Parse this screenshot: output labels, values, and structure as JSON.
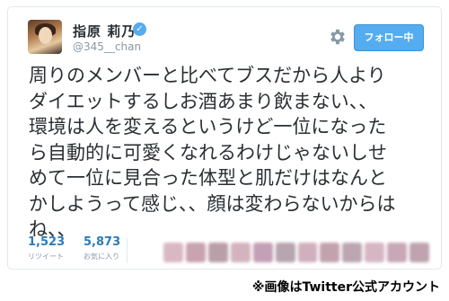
{
  "profile": {
    "display_name": "指原 莉乃",
    "handle": "@345__chan",
    "verified_mark": "✓"
  },
  "follow_button": {
    "label": "フォロー中"
  },
  "tweet": {
    "lines": [
      "周りのメンバーと比べてブスだから人より",
      "ダイエットするしお酒あまり飲まない、、",
      "環境は人を変えるというけど一位になった",
      "ら自動的に可愛くなれるわけじゃないしせ",
      "めて一位に見合った体型と肌だけはなんと",
      "かしようって感じ、、顔は変わらないからは",
      "ね、、"
    ]
  },
  "stats": {
    "retweets": {
      "value": "1,523",
      "label": "リツイート"
    },
    "favorites": {
      "value": "5,873",
      "label": "お気に入り"
    }
  },
  "caption": "※画像はTwitter公式アカウント",
  "colors": {
    "accent": "#55acee",
    "link": "#2b7bb9",
    "text": "#292f33",
    "muted": "#8899a6",
    "border": "#e1e8ed"
  },
  "icons": {
    "gear": "gear-icon",
    "verified": "verified-badge-icon"
  }
}
